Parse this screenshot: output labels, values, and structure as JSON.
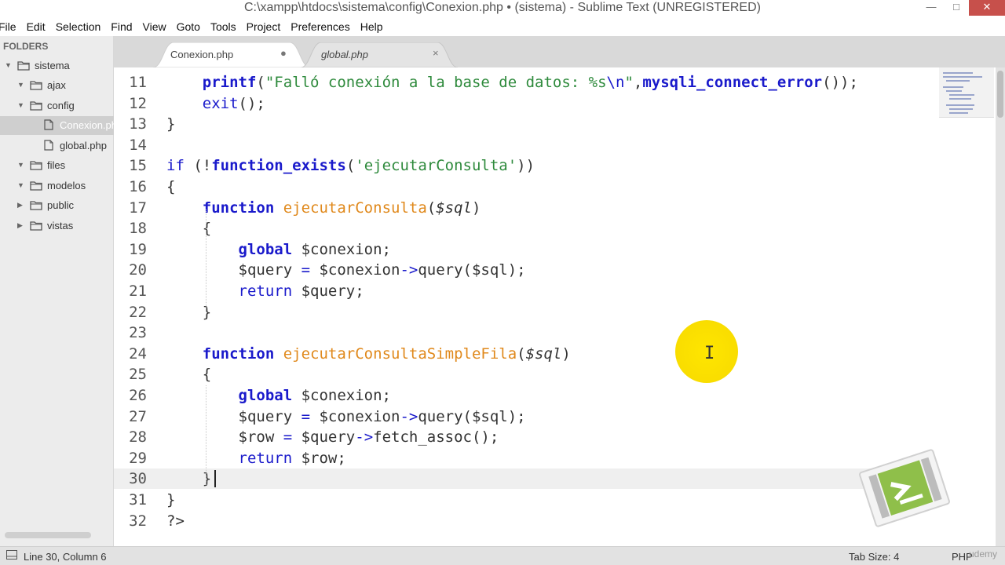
{
  "window": {
    "title": "C:\\xampp\\htdocs\\sistema\\config\\Conexion.php • (sistema) - Sublime Text (UNREGISTERED)",
    "minimize": "—",
    "maximize": "□",
    "close": "✕"
  },
  "menu": [
    "File",
    "Edit",
    "Selection",
    "Find",
    "View",
    "Goto",
    "Tools",
    "Project",
    "Preferences",
    "Help"
  ],
  "sidebar": {
    "title": "FOLDERS",
    "items": [
      {
        "label": "sistema",
        "level": 0,
        "type": "folder",
        "expanded": true
      },
      {
        "label": "ajax",
        "level": 1,
        "type": "folder",
        "expanded": true
      },
      {
        "label": "config",
        "level": 1,
        "type": "folder",
        "expanded": true
      },
      {
        "label": "Conexion.php",
        "level": 2,
        "type": "file",
        "active": true
      },
      {
        "label": "global.php",
        "level": 2,
        "type": "file"
      },
      {
        "label": "files",
        "level": 1,
        "type": "folder",
        "expanded": true
      },
      {
        "label": "modelos",
        "level": 1,
        "type": "folder",
        "expanded": true
      },
      {
        "label": "public",
        "level": 1,
        "type": "folder",
        "expanded": false
      },
      {
        "label": "vistas",
        "level": 1,
        "type": "folder",
        "expanded": false
      }
    ]
  },
  "tabs": [
    {
      "label": "Conexion.php",
      "active": true,
      "modified_indicator": "●"
    },
    {
      "label": "global.php",
      "active": false,
      "close": "×"
    }
  ],
  "editor": {
    "line_numbers": [
      "11",
      "12",
      "13",
      "14",
      "15",
      "16",
      "17",
      "18",
      "19",
      "20",
      "21",
      "22",
      "23",
      "24",
      "25",
      "26",
      "27",
      "28",
      "29",
      "30",
      "31",
      "32"
    ],
    "current_line": "30",
    "code": [
      [
        {
          "t": "    "
        },
        {
          "t": "printf",
          "c": "fn"
        },
        {
          "t": "("
        },
        {
          "t": "\"Falló conexión a la base de datos: %s",
          "c": "str"
        },
        {
          "t": "\\n",
          "c": "esc"
        },
        {
          "t": "\"",
          "c": "str"
        },
        {
          "t": ","
        },
        {
          "t": "mysqli_connect_error",
          "c": "fn"
        },
        {
          "t": "());"
        }
      ],
      [
        {
          "t": "    "
        },
        {
          "t": "exit",
          "c": "kw2"
        },
        {
          "t": "();"
        }
      ],
      [
        {
          "t": "}"
        }
      ],
      [
        {
          "t": ""
        }
      ],
      [
        {
          "t": "if",
          "c": "kw2"
        },
        {
          "t": " (!"
        },
        {
          "t": "function_exists",
          "c": "fn"
        },
        {
          "t": "("
        },
        {
          "t": "'ejecutarConsulta'",
          "c": "str"
        },
        {
          "t": "))"
        }
      ],
      [
        {
          "t": "{"
        }
      ],
      [
        {
          "t": "    "
        },
        {
          "t": "function",
          "c": "kw"
        },
        {
          "t": " "
        },
        {
          "t": "ejecutarConsulta",
          "c": "fdef"
        },
        {
          "t": "("
        },
        {
          "t": "$sql",
          "c": "vari"
        },
        {
          "t": ")"
        }
      ],
      [
        {
          "t": "    {"
        }
      ],
      [
        {
          "t": "        "
        },
        {
          "t": "global",
          "c": "kw"
        },
        {
          "t": " $conexion;"
        }
      ],
      [
        {
          "t": "        $query "
        },
        {
          "t": "=",
          "c": "kw2"
        },
        {
          "t": " $conexion"
        },
        {
          "t": "->",
          "c": "kw2"
        },
        {
          "t": "query($sql);"
        }
      ],
      [
        {
          "t": "        "
        },
        {
          "t": "return",
          "c": "kw2"
        },
        {
          "t": " $query;"
        }
      ],
      [
        {
          "t": "    }"
        }
      ],
      [
        {
          "t": ""
        }
      ],
      [
        {
          "t": "    "
        },
        {
          "t": "function",
          "c": "kw"
        },
        {
          "t": " "
        },
        {
          "t": "ejecutarConsultaSimpleFila",
          "c": "fdef"
        },
        {
          "t": "("
        },
        {
          "t": "$sql",
          "c": "vari"
        },
        {
          "t": ")"
        }
      ],
      [
        {
          "t": "    {"
        }
      ],
      [
        {
          "t": "        "
        },
        {
          "t": "global",
          "c": "kw"
        },
        {
          "t": " $conexion;"
        }
      ],
      [
        {
          "t": "        $query "
        },
        {
          "t": "=",
          "c": "kw2"
        },
        {
          "t": " $conexion"
        },
        {
          "t": "->",
          "c": "kw2"
        },
        {
          "t": "query($sql);"
        }
      ],
      [
        {
          "t": "        $row "
        },
        {
          "t": "=",
          "c": "kw2"
        },
        {
          "t": " $query"
        },
        {
          "t": "->",
          "c": "kw2"
        },
        {
          "t": "fetch_assoc();"
        }
      ],
      [
        {
          "t": "        "
        },
        {
          "t": "return",
          "c": "kw2"
        },
        {
          "t": " $row;"
        }
      ],
      [
        {
          "t": "    }"
        }
      ],
      [
        {
          "t": "}"
        }
      ],
      [
        {
          "t": "?>"
        }
      ]
    ]
  },
  "status": {
    "position": "Line 30, Column 6",
    "tab_size": "Tab Size: 4",
    "syntax": "PHP"
  },
  "watermark": "udemy",
  "colors": {
    "keyword": "#1a1acb",
    "function_def": "#e0891c",
    "string": "#2e8a3c",
    "cursor_highlight": "#ffe600",
    "logo_green": "#8fbf4a"
  }
}
